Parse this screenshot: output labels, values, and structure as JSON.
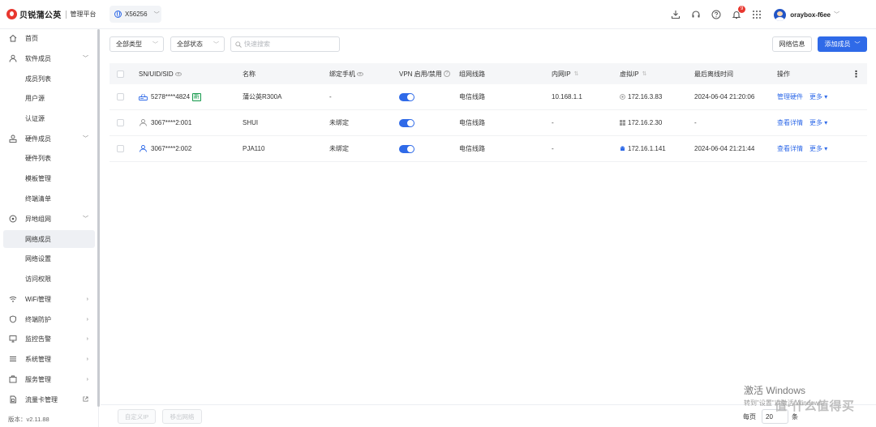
{
  "header": {
    "brand_name": "贝锐蒲公英",
    "brand_sub": "管理平台",
    "workspace": "X56256",
    "notification_count": "9",
    "username": "oraybox-f6ee"
  },
  "sidebar": {
    "items": [
      {
        "label": "首页"
      },
      {
        "label": "软件成员"
      },
      {
        "label": "成员列表"
      },
      {
        "label": "用户源"
      },
      {
        "label": "认证源"
      },
      {
        "label": "硬件成员"
      },
      {
        "label": "硬件列表"
      },
      {
        "label": "模板管理"
      },
      {
        "label": "终端清单"
      },
      {
        "label": "异地组网"
      },
      {
        "label": "网络成员"
      },
      {
        "label": "网络设置"
      },
      {
        "label": "访问权限"
      },
      {
        "label": "WiFi管理"
      },
      {
        "label": "终端防护"
      },
      {
        "label": "监控告警"
      },
      {
        "label": "系统管理"
      },
      {
        "label": "服务管理"
      },
      {
        "label": "流量卡管理"
      }
    ],
    "version": "版本：v2.11.88"
  },
  "toolbar": {
    "type_filter": "全部类型",
    "status_filter": "全部状态",
    "search_placeholder": "快速搜索",
    "network_info": "网络信息",
    "add_member": "添加成员"
  },
  "table": {
    "columns": [
      "SN/UID/SID",
      "名称",
      "绑定手机",
      "VPN 启用/禁用",
      "组网线路",
      "内网IP",
      "虚拟IP",
      "最后离线时间",
      "操作"
    ],
    "rows": [
      {
        "id": "5278****4824",
        "new_tag": "新",
        "name": "蒲公英R300A",
        "phone": "-",
        "line": "电信线路",
        "lan_ip": "10.168.1.1",
        "virtual_ip": "172.16.3.83",
        "last_offline": "2024-06-04 21:20:06",
        "action": "管理硬件",
        "more": "更多"
      },
      {
        "id": "3067****2:001",
        "name": "SHUI",
        "phone": "未绑定",
        "line": "电信线路",
        "lan_ip": "-",
        "virtual_ip": "172.16.2.30",
        "last_offline": "-",
        "action": "查看详情",
        "more": "更多"
      },
      {
        "id": "3067****2:002",
        "name": "PJA110",
        "phone": "未绑定",
        "line": "电信线路",
        "lan_ip": "-",
        "virtual_ip": "172.16.1.141",
        "last_offline": "2024-06-04 21:21:44",
        "action": "查看详情",
        "more": "更多"
      }
    ]
  },
  "footer": {
    "custom_ip": "自定义IP",
    "remove_network": "移出网络",
    "per_page": "每页",
    "page_size": "20",
    "unit": "条"
  },
  "watermark": {
    "line1": "激活 Windows",
    "line2": "转到\"设置\"以激活 Windows。",
    "zdm": "值·什么值得买"
  },
  "colors": {
    "accent": "#2f6ae8",
    "brand": "#e8372f",
    "new_tag": "#1a9b50"
  }
}
